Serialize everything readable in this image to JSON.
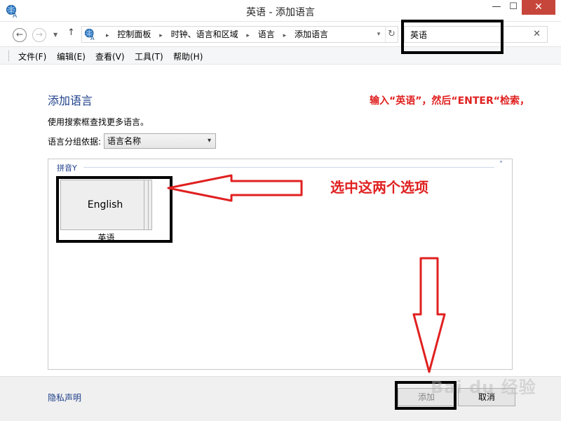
{
  "window": {
    "title": "英语 - 添加语言",
    "min_glyph": "—",
    "max_glyph": "☐",
    "close_glyph": "✕"
  },
  "nav": {
    "back_glyph": "←",
    "forward_glyph": "→",
    "dropdown_glyph": "▼",
    "up_glyph": "↑",
    "address_dropdown_glyph": "▾",
    "refresh_glyph": "↻",
    "crumb_separator": "▸",
    "breadcrumbs": [
      "控制面板",
      "时钟、语言和区域",
      "语言",
      "添加语言"
    ]
  },
  "search": {
    "value": "英语",
    "clear_glyph": "✕"
  },
  "menu": {
    "items": [
      "文件(F)",
      "编辑(E)",
      "查看(V)",
      "工具(T)",
      "帮助(H)"
    ]
  },
  "main": {
    "title": "添加语言",
    "subtitle": "使用搜索框查找更多语言。",
    "group_label": "语言分组依据:",
    "group_value": "语言名称",
    "group_arrow": "▾",
    "group_header": "拼音Y",
    "collapse_glyph": "˄",
    "tile_text": "English",
    "tile_label": "英语"
  },
  "annotations": {
    "search_note": "输入“英语”，然后“ENTER“检索，",
    "select_note": "选中这两个选项",
    "watermark": "Bai du 经验"
  },
  "footer": {
    "privacy_link": "隐私声明",
    "add_button": "添加",
    "cancel_button": "取消"
  },
  "colors": {
    "accent_blue": "#1e3f8a",
    "annotation_red": "#e02020",
    "close_red": "#c7463c",
    "highlight_black": "#000000"
  },
  "icons": {
    "app": "language-globe-icon",
    "address": "language-globe-icon",
    "clear": "close-icon",
    "refresh": "refresh-icon",
    "back": "arrow-left-icon",
    "forward": "arrow-right-icon",
    "up": "arrow-up-icon"
  }
}
